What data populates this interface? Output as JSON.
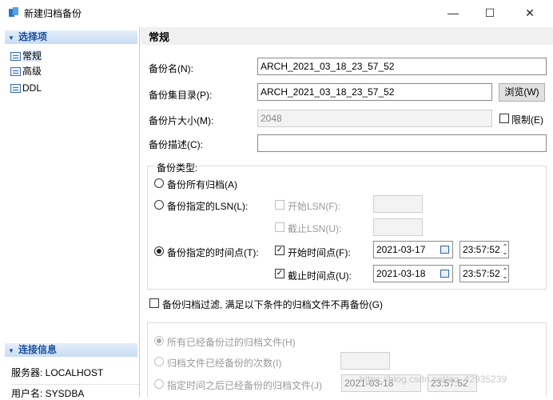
{
  "window": {
    "title": "新建归档备份",
    "minimize_glyph": "—",
    "maximize_glyph": "☐",
    "close_glyph": "✕"
  },
  "sidebar": {
    "select_header": "选择项",
    "items": [
      {
        "label": "常规",
        "icon": "page-icon",
        "selected": true
      },
      {
        "label": "高级",
        "icon": "page-icon",
        "selected": false
      },
      {
        "label": "DDL",
        "icon": "page-icon",
        "selected": false
      }
    ],
    "connection_header": "连接信息",
    "server": "服务器: LOCALHOST",
    "user": "用户名: SYSDBA"
  },
  "main": {
    "section_title": "常规",
    "backup_name_label": "备份名(N):",
    "backup_name_value": "ARCH_2021_03_18_23_57_52",
    "backup_dir_label": "备份集目录(P):",
    "backup_dir_value": "ARCH_2021_03_18_23_57_52",
    "browse_button": "浏览(W)",
    "piece_size_label": "备份片大小(M):",
    "piece_size_value": "2048",
    "limit_label": "限制(E)",
    "description_label": "备份描述(C):",
    "description_value": "",
    "backup_type_label": "备份类型:",
    "type_all": "备份所有归档(A)",
    "type_lsn": "备份指定的LSN(L):",
    "start_lsn_label": "开始LSN(F):",
    "end_lsn_label": "截止LSN(U):",
    "type_time": "备份指定的时间点(T):",
    "start_time_label": "开始时间点(F):",
    "start_date": "2021-03-17",
    "start_time": "23:57:52",
    "end_time_label": "截止时间点(U):",
    "end_date": "2021-03-18",
    "end_time": "23:57:52",
    "filter_label": "备份归档过滤, 满足以下条件的归档文件不再备份(G)",
    "filter_all": "所有已经备份过的归档文件(H)",
    "filter_count": "归档文件已经备份的次数(I)",
    "filter_after": "指定时间之后已经备份的归档文件(J)",
    "filter_date": "2021-03-18",
    "filter_time": "23:57:52"
  },
  "watermark": "https://blog.csdn.net/qq_42935239",
  "colors": {
    "accent": "#1f4f9e",
    "sidebar_header_bg": "#c9dcf3",
    "main_header_bg": "#f0f0f0"
  }
}
